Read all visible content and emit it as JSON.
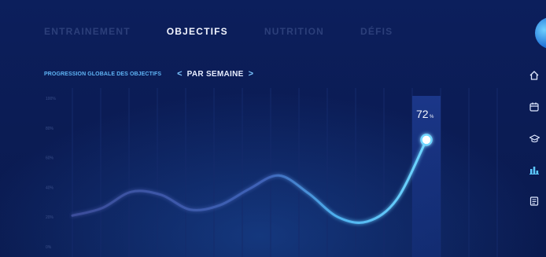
{
  "tabs": [
    {
      "label": "ENTRAINEMENT",
      "active": false
    },
    {
      "label": "OBJECTIFS",
      "active": true
    },
    {
      "label": "NUTRITION",
      "active": false
    },
    {
      "label": "DÉFIS",
      "active": false
    }
  ],
  "chart_header": {
    "title": "PROGRESSION GLOBALE DES OBJECTIFS",
    "period_label": "PAR SEMAINE",
    "prev_arrow": "<",
    "next_arrow": ">"
  },
  "sidebar": {
    "icons": [
      "home-icon",
      "calendar-icon",
      "graduation-cap-icon",
      "bar-chart-icon",
      "notes-icon"
    ],
    "active_icon": "bar-chart-icon"
  },
  "colors": {
    "background": "#0b1c55",
    "line_highlight": "#5cc8ff",
    "line_dim": "#3b4d9a",
    "active_tab": "#f2f5ff",
    "inactive_tab": "#2c3f7a"
  },
  "chart_data": {
    "type": "line",
    "title": "PROGRESSION GLOBALE DES OBJECTIFS",
    "xlabel": "",
    "ylabel": "",
    "ylim": [
      0,
      100
    ],
    "yticks": [
      "0%",
      "20%",
      "40%",
      "60%",
      "80%",
      "100%"
    ],
    "grid": true,
    "series": [
      {
        "values": [
          21,
          26,
          37,
          35,
          25,
          28,
          39,
          48,
          36,
          20,
          17,
          32,
          72
        ]
      }
    ],
    "highlight": {
      "index": 12,
      "value": "72",
      "unit": "%"
    }
  }
}
